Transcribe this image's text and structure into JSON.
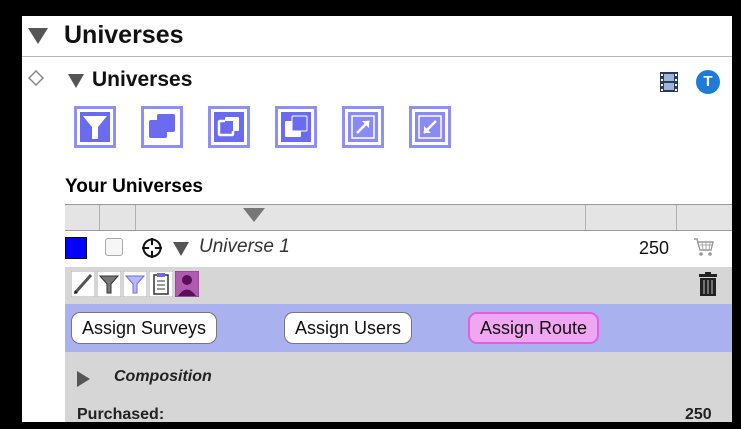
{
  "header": {
    "title": "Universes"
  },
  "section": {
    "title": "Universes",
    "info_glyph": "T"
  },
  "toolbar": {
    "icons": [
      "filter-icon",
      "union-icon",
      "intersect-icon",
      "subtract-icon",
      "expand-icon",
      "shrink-icon"
    ],
    "accent_color": "#8f8ff8"
  },
  "list": {
    "heading": "Your Universes"
  },
  "universe": {
    "name": "Universe 1",
    "count": "250",
    "color": "#0000ff"
  },
  "actions": {
    "assign_surveys": "Assign Surveys",
    "assign_users": "Assign Users",
    "assign_route": "Assign Route"
  },
  "details": {
    "composition_label": "Composition",
    "purchased_label": "Purchased:",
    "purchased_value": "250"
  }
}
